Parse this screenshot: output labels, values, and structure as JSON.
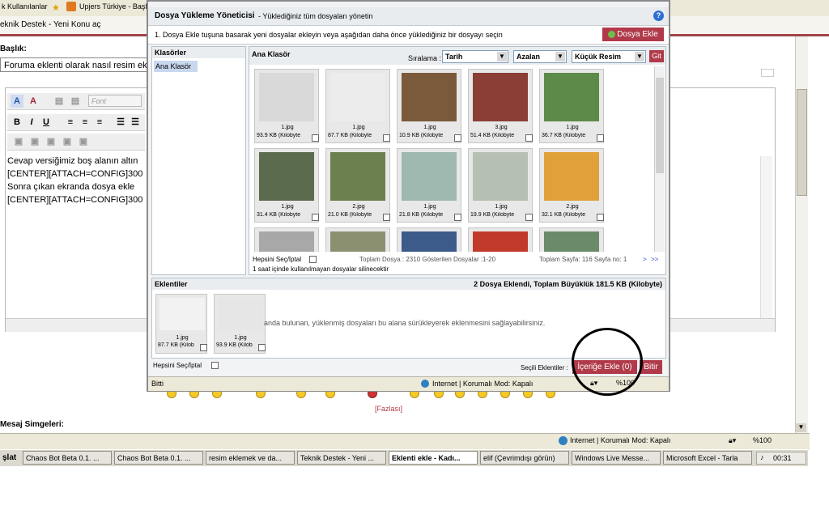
{
  "colors": {
    "accent": "#b03a4a",
    "panel_header": "#eaedf0",
    "selection": "#c8d8ef",
    "circle": "#000000"
  },
  "browser": {
    "favorites": "k Kullanılanlar",
    "fav_link": "Upjers Türkiye - Başlık",
    "tab_title": "eknik Destek - Yeni Konu aç",
    "field_label": "Başlık:",
    "title_value": "Foruma eklenti olarak nasıl resim ekle",
    "editor_font": "Font",
    "editor_lines": [
      "Cevap versiğimiz boş alanın altın",
      "[CENTER][ATTACH=CONFIG]300",
      "Sonra çıkan ekranda dosya ekle",
      "[CENTER][ATTACH=CONFIG]300"
    ],
    "more_link": "[Fazlası]",
    "smilies_label": "Mesaj Simgeleri:",
    "status_zone": "Internet | Korumalı Mod: Kapalı",
    "zoom": "%100"
  },
  "taskbar": {
    "start": "şlat",
    "items": [
      {
        "label": "Chaos Bot Beta 0.1. ..."
      },
      {
        "label": "Chaos Bot Beta 0.1. ..."
      },
      {
        "label": "resim eklemek ve da..."
      },
      {
        "label": "Teknik Destek - Yeni ..."
      },
      {
        "label": "Eklenti ekle - Kadı..."
      },
      {
        "label": "elif (Çevrimdışı görün)"
      },
      {
        "label": "Windows Live Messe..."
      },
      {
        "label": "Microsoft Excel - Tarla"
      }
    ],
    "clock": "00:31"
  },
  "dialog": {
    "title": "Dosya Yükleme Yöneticisi",
    "subtitle": "- Yüklediğiniz tüm dosyaları yönetin",
    "help": "?",
    "instruction": "1. Dosya Ekle tuşuna basarak yeni dosyalar ekleyin veya aşağıdan daha önce yüklediğiniz bir dosyayı seçin",
    "add_file": "Dosya Ekle",
    "folders_header": "Klasörler",
    "folder_item": "Ana Klasör",
    "main_header": "Ana Klasör",
    "sort_label": "Sıralama :",
    "sort_value": "Tarih",
    "order_value": "Azalan",
    "size_value": "Küçük Resim",
    "go": "Git",
    "thumbs": [
      {
        "name": "1.jpg",
        "size": "93.9 KB (Kilobyte",
        "color": "#d9d9d9"
      },
      {
        "name": "1.jpg",
        "size": "87.7 KB (Kilobyte",
        "color": "#ececec"
      },
      {
        "name": "1.jpg",
        "size": "10.9 KB (Kilobyte",
        "color": "#7a5a3a"
      },
      {
        "name": "3.jpg",
        "size": "51.4 KB (Kilobyte",
        "color": "#8a3e35"
      },
      {
        "name": "1.jpg",
        "size": "36.7 KB (Kilobyte",
        "color": "#5d8a48"
      },
      {
        "name": "1.jpg",
        "size": "31.4 KB (Kilobyte",
        "color": "#5b6b4d"
      },
      {
        "name": "2.jpg",
        "size": "21.0 KB (Kilobyte",
        "color": "#6c7f4e"
      },
      {
        "name": "1.jpg",
        "size": "21.8 KB (Kilobyte",
        "color": "#9fb8b0"
      },
      {
        "name": "1.jpg",
        "size": "19.9 KB (Kilobyte",
        "color": "#b6c0b2"
      },
      {
        "name": "2.jpg",
        "size": "32.1 KB (Kilobyte",
        "color": "#e0a03a"
      },
      {
        "name": "",
        "size": "",
        "color": "#a8a8a8"
      },
      {
        "name": "",
        "size": "",
        "color": "#8b9070"
      },
      {
        "name": "",
        "size": "",
        "color": "#3c5a8a"
      },
      {
        "name": "",
        "size": "",
        "color": "#c0392b"
      },
      {
        "name": "",
        "size": "",
        "color": "#6a8a6a"
      }
    ],
    "select_all": "Hepsini Seç/İptal",
    "total_files": "Toplam Dosya : 2310 Gösterilen Dosyalar :1-20",
    "total_pages": "Toplam Sayfa: 116 Sayfa no: 1",
    "next": ">",
    "last": ">>",
    "cleanup_note": "1 saat içinde kullanılmayan dosyalar silinecektir",
    "attachments_header": "Eklentiler",
    "attachments_summary": "2 Dosya Eklendi, Toplam Büyüklük 181.5 KB (Kilobyte)",
    "drop_hint": "anda bulunan, yüklenmiş dosyaları bu alana sürükleyerek eklenmesini sağlayabilirsiniz.",
    "attached": [
      {
        "name": "1.jpg",
        "size": "87.7 KB (Kilob"
      },
      {
        "name": "1.jpg",
        "size": "93.9 KB (Kilob"
      }
    ],
    "selected_label": "Seçili Eklentiler :",
    "insert": "İçeriğe Ekle (0)",
    "finish": "Bitir",
    "status_left": "Bitti",
    "status_zone": "Internet | Korumalı Mod: Kapalı",
    "zoom": "%100"
  }
}
